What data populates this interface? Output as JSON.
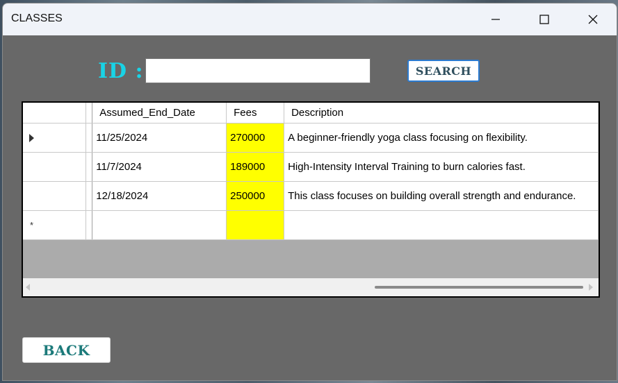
{
  "window": {
    "title": "CLASSES",
    "minimize_icon": "minimize-icon",
    "maximize_icon": "maximize-icon",
    "close_icon": "close-icon"
  },
  "search": {
    "label": "ID :",
    "value": "",
    "button_label": "SEARCH",
    "label_color": "#19d3e6"
  },
  "grid": {
    "columns": [
      "Assumed_End_Date",
      "Fees",
      "Description"
    ],
    "rows": [
      {
        "date": "11/25/2024",
        "fees": "270000",
        "description": "A beginner-friendly yoga class focusing on flexibility."
      },
      {
        "date": "11/7/2024",
        "fees": "189000",
        "description": "High-Intensity Interval Training to burn calories fast."
      },
      {
        "date": "12/18/2024",
        "fees": "250000",
        "description": "This class focuses on building overall strength and endurance."
      }
    ],
    "new_row_marker": "*",
    "current_row_icon": "row-pointer-icon",
    "fees_highlight_color": "#ffff00"
  },
  "footer": {
    "back_label": "BACK"
  }
}
